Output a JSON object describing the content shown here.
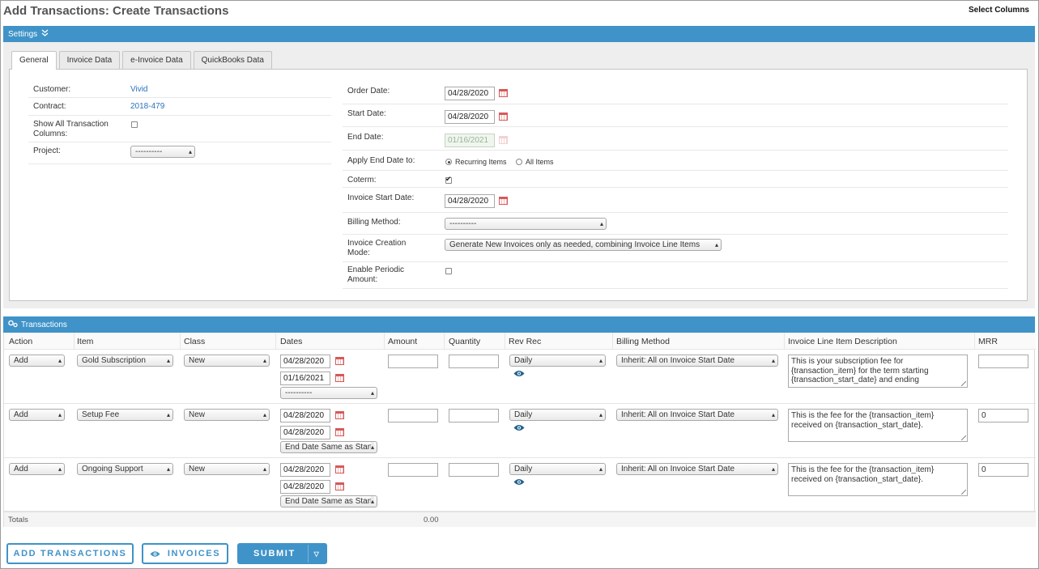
{
  "page": {
    "title": "Add Transactions: Create Transactions",
    "select_columns": "Select Columns"
  },
  "settings": {
    "label": "Settings",
    "tabs": [
      "General",
      "Invoice Data",
      "e-Invoice Data",
      "QuickBooks Data"
    ],
    "active_tab": "General",
    "left": {
      "customer_label": "Customer:",
      "customer_value": "Vivid",
      "contract_label": "Contract:",
      "contract_value": "2018-479",
      "show_all_label": "Show All Transaction Columns:",
      "project_label": "Project:",
      "project_value": "----------"
    },
    "right": {
      "order_date_label": "Order Date:",
      "order_date_value": "04/28/2020",
      "start_date_label": "Start Date:",
      "start_date_value": "04/28/2020",
      "end_date_label": "End Date:",
      "end_date_value": "01/16/2021",
      "apply_end_label": "Apply End Date to:",
      "apply_end_options": [
        "Recurring Items",
        "All Items"
      ],
      "apply_end_selected": "Recurring Items",
      "coterm_label": "Coterm:",
      "coterm_checked": true,
      "invoice_start_label": "Invoice Start Date:",
      "invoice_start_value": "04/28/2020",
      "billing_method_label": "Billing Method:",
      "billing_method_value": "----------",
      "creation_mode_label": "Invoice Creation Mode:",
      "creation_mode_value": "Generate New Invoices only as needed, combining Invoice Line Items",
      "periodic_label": "Enable Periodic Amount:",
      "periodic_checked": false
    }
  },
  "transactions": {
    "label": "Transactions",
    "columns": [
      "Action",
      "Item",
      "Class",
      "Dates",
      "Amount",
      "Quantity",
      "Rev Rec",
      "Billing Method",
      "Invoice Line Item Description",
      "MRR"
    ],
    "rows": [
      {
        "action": "Add",
        "item": "Gold Subscription",
        "class": "New",
        "start": "04/28/2020",
        "end": "01/16/2021",
        "date_option": "----------",
        "amount": "",
        "quantity": "",
        "rev_rec": "Daily",
        "billing": "Inherit: All on Invoice Start Date",
        "description": "This is your subscription fee for {transaction_item} for the term starting {transaction_start_date} and ending",
        "mrr": ""
      },
      {
        "action": "Add",
        "item": "Setup Fee",
        "class": "New",
        "start": "04/28/2020",
        "end": "04/28/2020",
        "date_option": "End Date Same as Start",
        "amount": "",
        "quantity": "",
        "rev_rec": "Daily",
        "billing": "Inherit: All on Invoice Start Date",
        "description": "This is the fee for the {transaction_item} received on {transaction_start_date}.",
        "mrr": "0"
      },
      {
        "action": "Add",
        "item": "Ongoing Support",
        "class": "New",
        "start": "04/28/2020",
        "end": "04/28/2020",
        "date_option": "End Date Same as Start",
        "amount": "",
        "quantity": "",
        "rev_rec": "Daily",
        "billing": "Inherit: All on Invoice Start Date",
        "description": "This is the fee for the {transaction_item} received on {transaction_start_date}.",
        "mrr": "0"
      }
    ],
    "totals_label": "Totals",
    "totals_amount": "0.00"
  },
  "buttons": {
    "add_transactions": "ADD TRANSACTIONS",
    "invoices": "INVOICES",
    "submit": "SUBMIT"
  },
  "colors": {
    "accent": "#3f93c8",
    "link": "#2a73b8"
  }
}
